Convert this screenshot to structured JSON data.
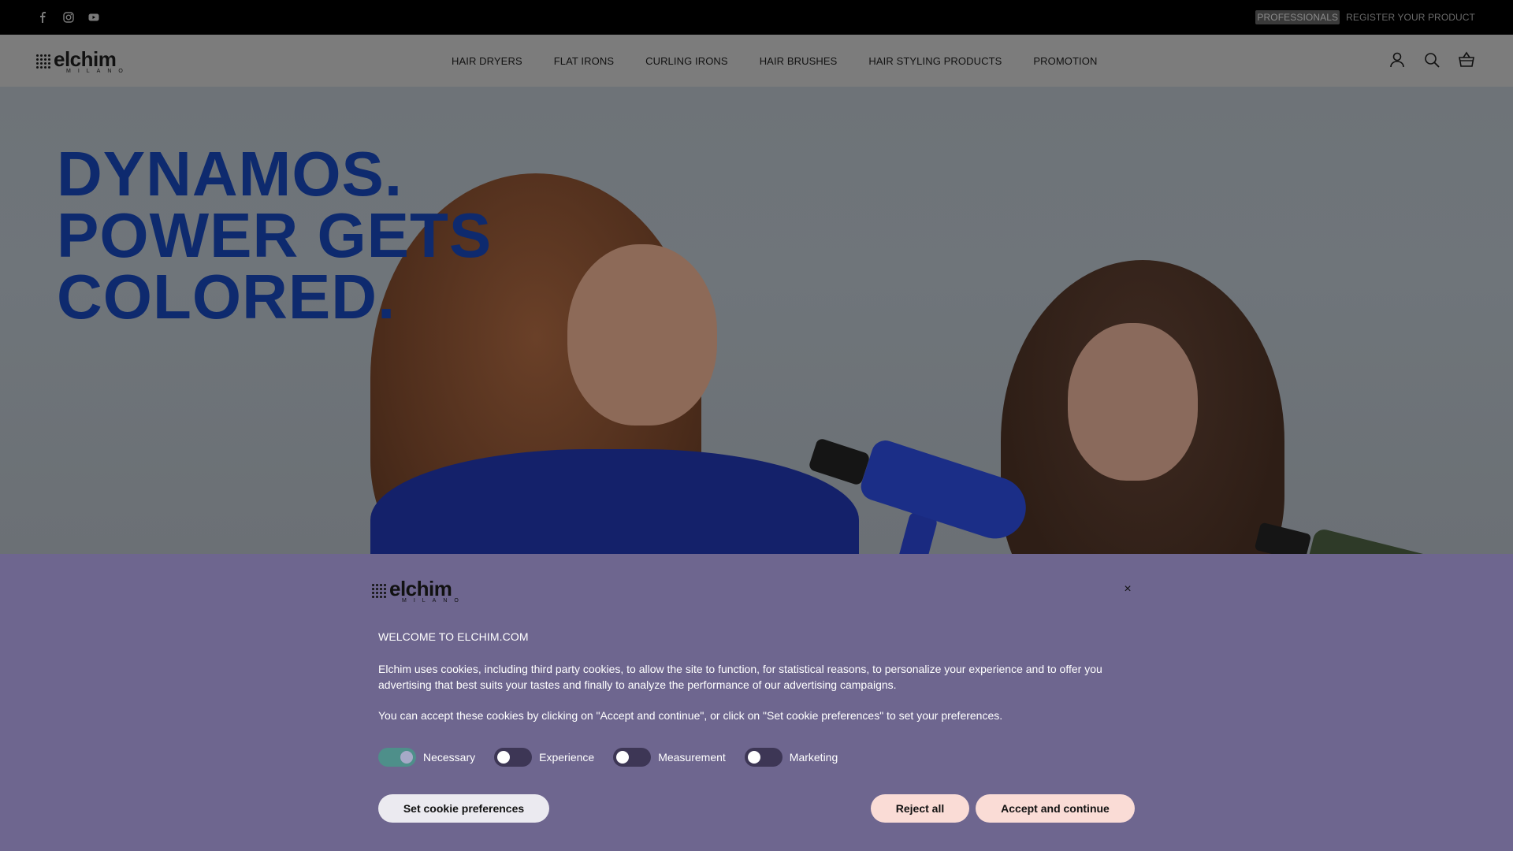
{
  "topbar": {
    "social": [
      "facebook-icon",
      "instagram-icon",
      "youtube-icon"
    ],
    "professionals": "PROFESSIONALS",
    "register": "REGISTER YOUR PRODUCT"
  },
  "header": {
    "logo_word": "elchim",
    "logo_sub": "MILANO",
    "nav": [
      "HAIR DRYERS",
      "FLAT IRONS",
      "CURLING IRONS",
      "HAIR BRUSHES",
      "HAIR STYLING PRODUCTS",
      "PROMOTION"
    ],
    "icons": [
      "account-icon",
      "search-icon",
      "cart-icon"
    ]
  },
  "hero": {
    "headline": [
      "DYNAMOS.",
      "POWER GETS",
      "COLORED."
    ]
  },
  "cookie": {
    "logo_word": "elchim",
    "logo_sub": "MILANO",
    "close": "×",
    "title": "WELCOME TO ELCHIM.COM",
    "paragraph1": "Elchim uses cookies, including third party cookies, to allow the site to function, for statistical reasons, to personalize your experience and to offer you advertising that best suits your tastes and finally to analyze the performance of our advertising campaigns.",
    "paragraph2": "You can accept these cookies by clicking on \"Accept and continue\", or click on \"Set cookie preferences\" to set your preferences.",
    "toggles": [
      {
        "label": "Necessary",
        "on": true
      },
      {
        "label": "Experience",
        "on": false
      },
      {
        "label": "Measurement",
        "on": false
      },
      {
        "label": "Marketing",
        "on": false
      }
    ],
    "set_prefs": "Set cookie preferences",
    "reject": "Reject all",
    "accept": "Accept and continue"
  },
  "colors": {
    "headline": "#0e2a6e",
    "banner": "#6e668f",
    "toggle_on": "#4e8f8a",
    "button_pink": "#fadcd6"
  }
}
